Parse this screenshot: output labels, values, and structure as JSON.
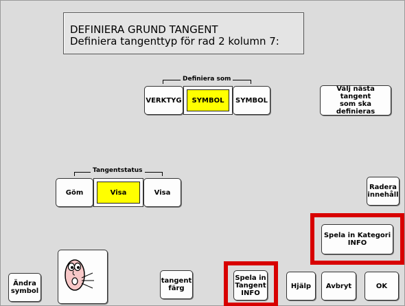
{
  "header": {
    "line1": "DEFINIERA GRUND TANGENT",
    "line2": "Definiera tangenttyp för rad 2 kolumn 7:"
  },
  "define_as": {
    "label": "Definiera som",
    "options": [
      "VERKTYG",
      "SYMBOL",
      "SYMBOL"
    ],
    "selected": "SYMBOL"
  },
  "key_status": {
    "label": "Tangentstatus",
    "options": [
      "Göm",
      "Visa",
      "Visa"
    ],
    "selected": "Visa"
  },
  "right_buttons": {
    "next_key_line1": "Välj nästa tangent",
    "next_key_line2": "som ska definieras",
    "clear_line1": "Radera",
    "clear_line2": "innehåll",
    "record_category_line1": "Spela in Kategori",
    "record_category_line2": "INFO"
  },
  "bottom_bar": {
    "change_symbol_line1": "Ändra",
    "change_symbol_line2": "symbol",
    "key_color_line1": "tangent",
    "key_color_line2": "färg",
    "record_key_line1": "Spela in",
    "record_key_line2": "Tangent",
    "record_key_line3": "INFO",
    "help": "Hjälp",
    "cancel": "Avbryt",
    "ok": "OK"
  },
  "colors": {
    "background": "#dcdcdc",
    "selected": "#ffff00",
    "highlight_border": "#d80000"
  },
  "icons": {
    "symbol_preview": "speaking-face-icon"
  }
}
